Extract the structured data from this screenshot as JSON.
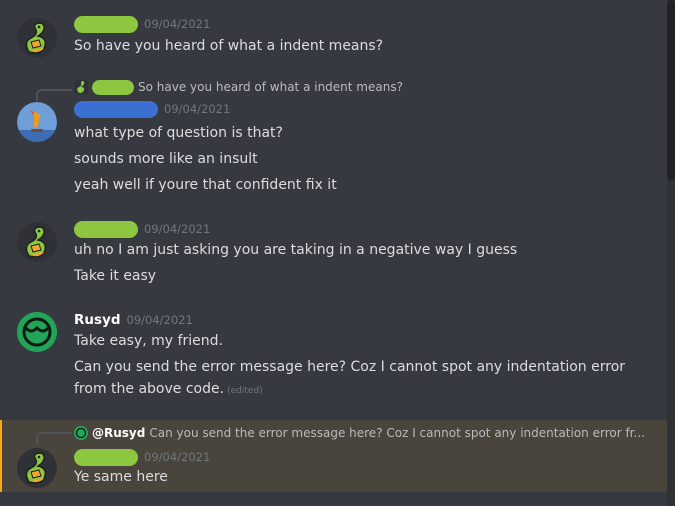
{
  "messages": [
    {
      "timestamp": "09/04/2021",
      "lines": [
        "So have you heard of what a indent means?"
      ]
    },
    {
      "reply_text": "So have you heard of what a indent means?",
      "timestamp": "09/04/2021",
      "lines": [
        "what type of question is that?",
        "sounds more like an insult",
        "yeah well if youre that confident fix it"
      ]
    },
    {
      "timestamp": "09/04/2021",
      "lines": [
        "uh no I am just asking you are taking in a negative way I guess",
        "Take it easy"
      ]
    },
    {
      "author": "Rusyd",
      "timestamp": "09/04/2021",
      "lines": [
        "Take easy, my friend.",
        "Can you send the error message here? Coz I cannot spot any indentation error",
        "from the above code."
      ],
      "edited": "(edited)"
    },
    {
      "reply_mention": "@Rusyd",
      "reply_text": "Can you send the error message here? Coz I cannot spot any indentation error fr...",
      "timestamp": "09/04/2021",
      "lines": [
        "Ye same here"
      ]
    }
  ],
  "colors": {
    "background": "#36393f",
    "highlight_bg": "#49443c",
    "highlight_bar": "#faa81a",
    "redaction_green": "#8dc63f",
    "redaction_blue": "#3b6fd1",
    "rusyd_avatar": "#23a559"
  },
  "icons": {
    "snake_avatar": "snake-avatar-icon",
    "bird_avatar": "bird-avatar-icon",
    "rusyd_avatar": "rusyd-avatar-icon"
  }
}
